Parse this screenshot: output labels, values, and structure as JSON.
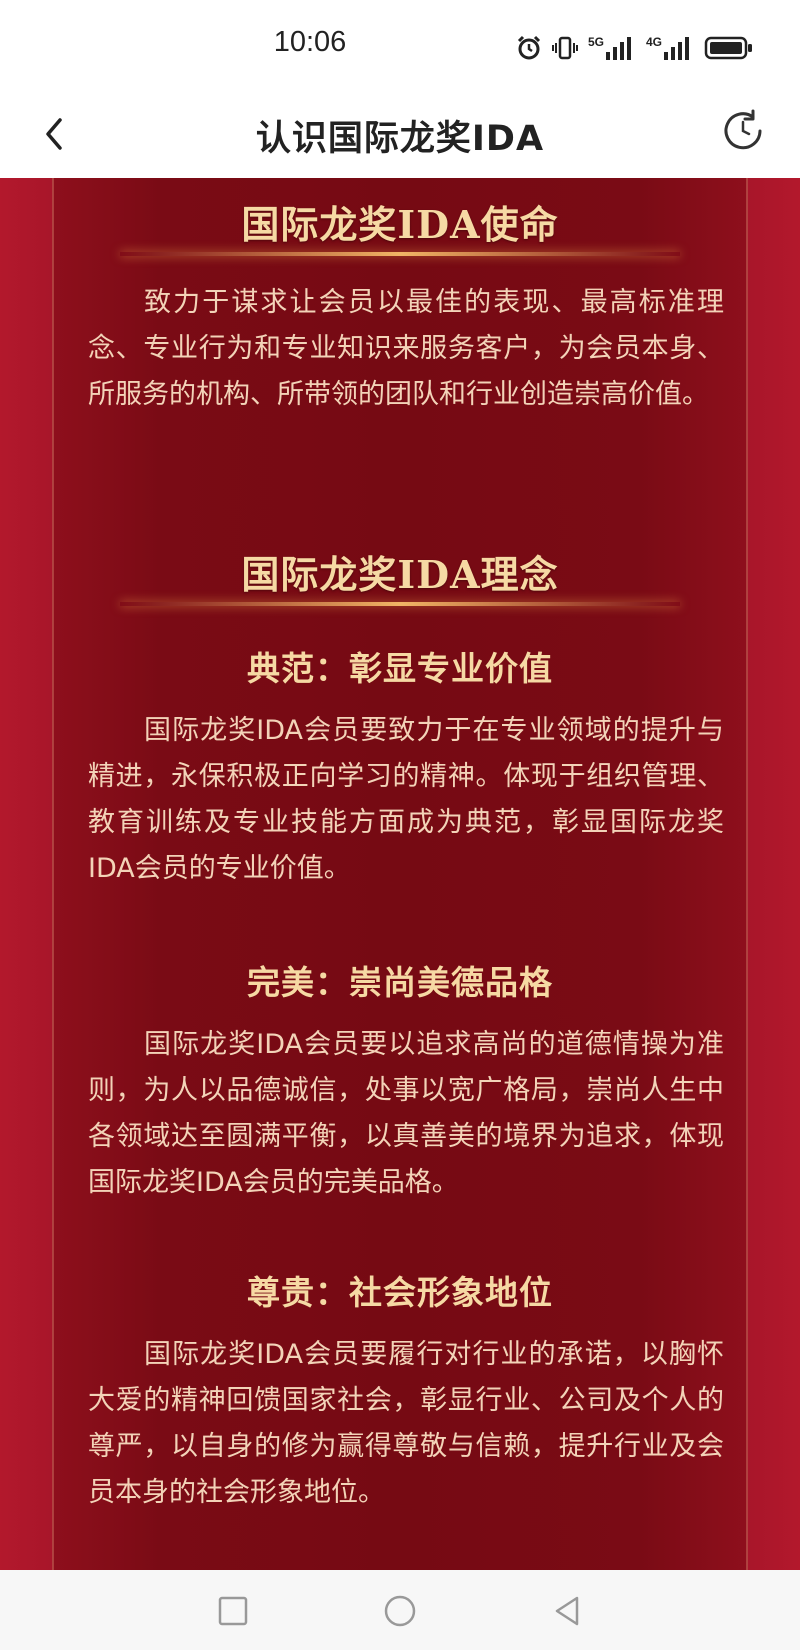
{
  "status_bar": {
    "time": "10:06",
    "icons": [
      "alarm-icon",
      "vibrate-icon",
      "signal-5g-icon",
      "signal-4g-icon",
      "battery-icon"
    ],
    "network_labels": [
      "5G",
      "4G"
    ]
  },
  "header": {
    "title": "认识国际龙奖IDA",
    "back_icon": "chevron-left-icon",
    "refresh_icon": "refresh-icon"
  },
  "mission": {
    "heading": "国际龙奖IDA使命",
    "text": "致力于谋求让会员以最佳的表现、最高标准理念、专业行为和专业知识来服务客户，为会员本身、所服务的机构、所带领的团队和行业创造崇高价值。"
  },
  "philosophy": {
    "heading": "国际龙奖IDA理念",
    "items": [
      {
        "title": "典范：彰显专业价值",
        "text": "国际龙奖IDA会员要致力于在专业领域的提升与精进，永保积极正向学习的精神。体现于组织管理、教育训练及专业技能方面成为典范，彰显国际龙奖IDA会员的专业价值。"
      },
      {
        "title": "完美：崇尚美德品格",
        "text": "国际龙奖IDA会员要以追求高尚的道德情操为准则，为人以品德诚信，处事以宽广格局，崇尚人生中各领域达至圆满平衡，以真善美的境界为追求，体现国际龙奖IDA会员的完美品格。"
      },
      {
        "title": "尊贵：社会形象地位",
        "text": "国际龙奖IDA会员要履行对行业的承诺，以胸怀大爱的精神回馈国家社会，彰显行业、公司及个人的尊严，以自身的修为赢得尊敬与信赖，提升行业及会员本身的社会形象地位。"
      }
    ]
  },
  "nav_bar": {
    "icons": [
      "square-icon",
      "circle-icon",
      "triangle-back-icon"
    ]
  },
  "colors": {
    "heading_gold": "#f6d9a4",
    "body_text": "#f3d3b8",
    "panel_red": "#760a13",
    "edge_red": "#b3182c"
  }
}
